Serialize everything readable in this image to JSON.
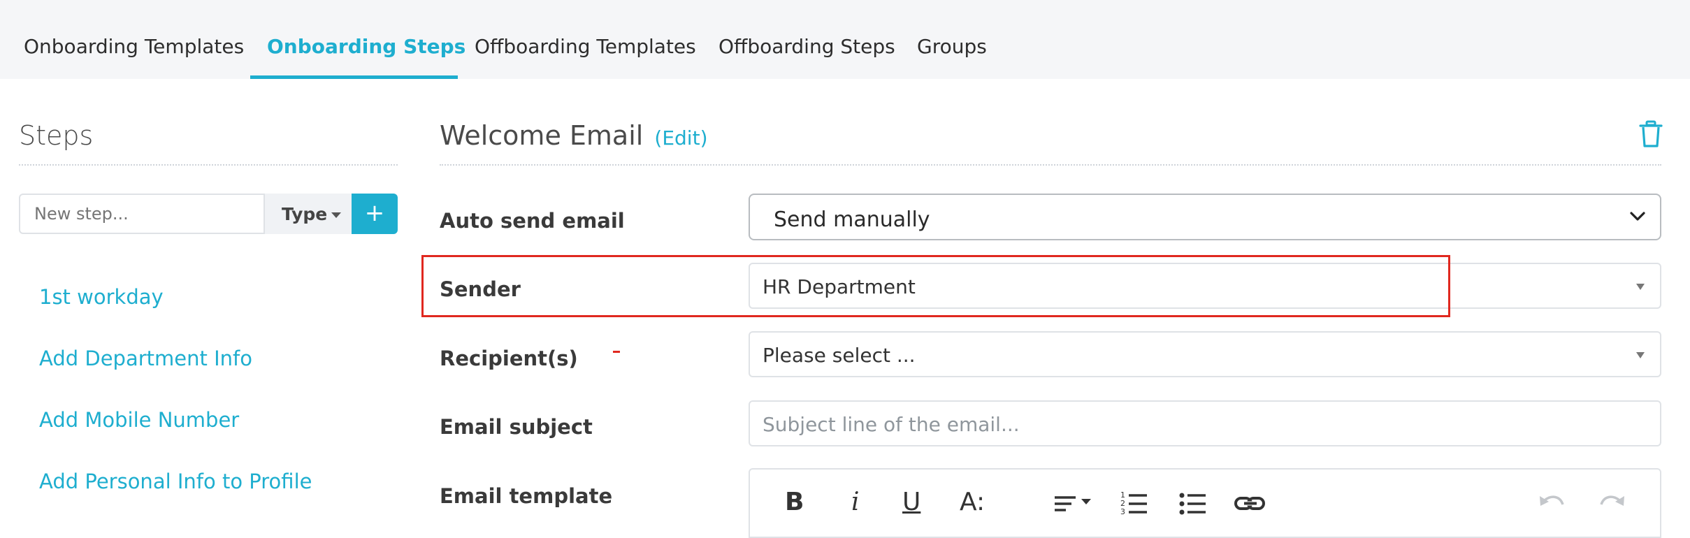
{
  "tabs": [
    {
      "label": "Onboarding Templates"
    },
    {
      "label": "Onboarding Steps"
    },
    {
      "label": "Offboarding Templates"
    },
    {
      "label": "Offboarding Steps"
    },
    {
      "label": "Groups"
    }
  ],
  "steps": {
    "title": "Steps",
    "new_step_placeholder": "New step...",
    "type_label": "Type",
    "add_label": "+",
    "items": [
      {
        "label": "1st workday"
      },
      {
        "label": "Add Department Info"
      },
      {
        "label": "Add Mobile Number"
      },
      {
        "label": "Add Personal Info to Profile"
      }
    ]
  },
  "detail": {
    "title": "Welcome Email",
    "edit_label": "(Edit)",
    "fields": {
      "auto_send": {
        "label": "Auto send email",
        "value": "Send manually"
      },
      "sender": {
        "label": "Sender",
        "value": "HR Department"
      },
      "recipients": {
        "label": "Recipient(s)",
        "value": "Please select ..."
      },
      "subject": {
        "label": "Email subject",
        "placeholder": "Subject line of the email..."
      },
      "template": {
        "label": "Email template"
      }
    },
    "toolbar": {
      "bold": "B",
      "italic": "i",
      "underline": "U",
      "font_size": "A:"
    }
  },
  "colors": {
    "accent": "#1eaecf",
    "highlight": "#e0281f"
  }
}
